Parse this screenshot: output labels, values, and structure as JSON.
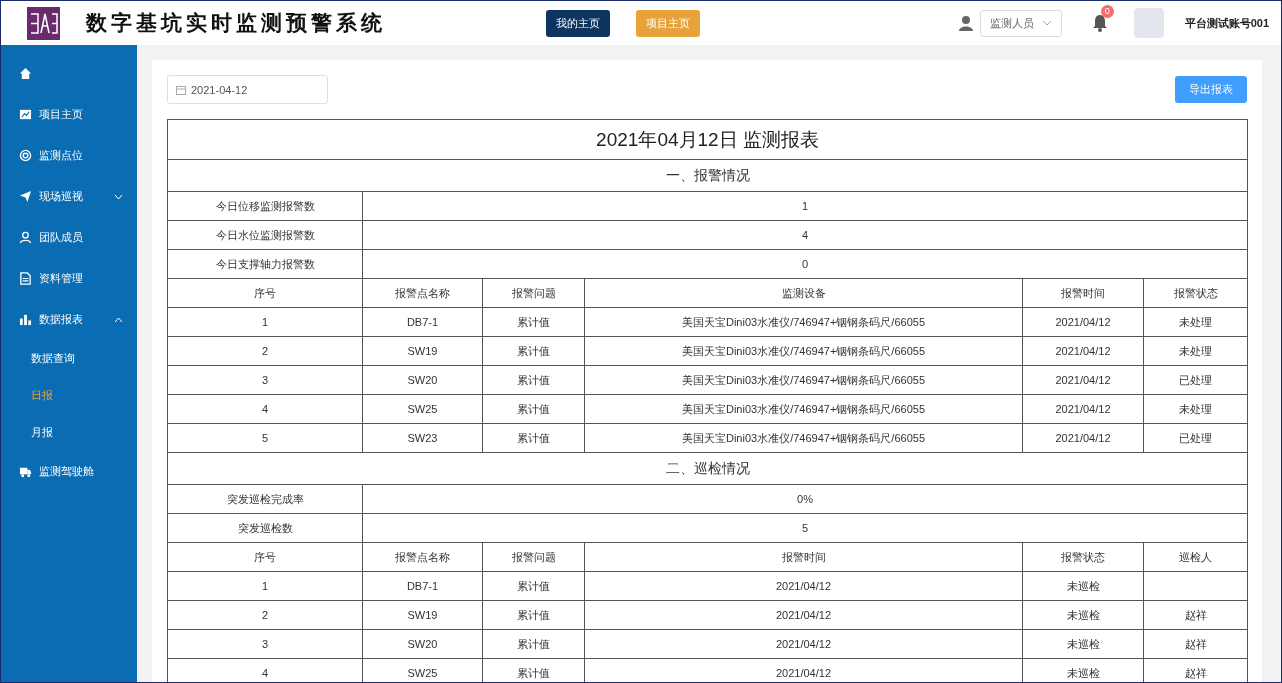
{
  "header": {
    "title": "数字基坑实时监测预警系统",
    "buttons": [
      {
        "label": "我的主页",
        "kind": "primary"
      },
      {
        "label": "项目主页",
        "kind": "warning"
      }
    ],
    "role_select": {
      "value": "监测人员"
    },
    "notifications": {
      "badge": "0"
    },
    "account": "平台测试账号001"
  },
  "sidebar": {
    "items": [
      {
        "kind": "home",
        "selected": false
      },
      {
        "kind": "chart",
        "label": "项目主页",
        "selected": false
      },
      {
        "kind": "target",
        "label": "监测点位",
        "selected": false
      },
      {
        "kind": "plane",
        "label": "现场巡视",
        "selected": false,
        "expanded": false
      },
      {
        "kind": "person",
        "label": "团队成员",
        "selected": false
      },
      {
        "kind": "document",
        "label": "资料管理",
        "selected": false
      },
      {
        "kind": "bars",
        "label": "数据报表",
        "selected": false,
        "expanded": true,
        "children": [
          {
            "label": "数据查询",
            "selected": false
          },
          {
            "label": "日报",
            "selected": true
          },
          {
            "label": "月报",
            "selected": false
          }
        ]
      },
      {
        "kind": "truck",
        "label": "监测驾驶舱",
        "selected": false
      }
    ]
  },
  "report": {
    "date_field": {
      "value": "2021-04-12"
    },
    "export_button": "导出报表",
    "title": "2021年04月12日 监测报表",
    "sections": [
      {
        "heading": "一、报警情况",
        "summary": [
          {
            "label": "今日位移监测报警数",
            "value": "1"
          },
          {
            "label": "今日水位监测报警数",
            "value": "4"
          },
          {
            "label": "今日支撑轴力报警数",
            "value": "0"
          }
        ],
        "columns": [
          "序号",
          "报警点名称",
          "报警问题",
          "监测设备",
          "报警时间",
          "报警状态"
        ],
        "rows": [
          [
            "1",
            "DB7-1",
            "累计值",
            "美国天宝Dini03水准仪/746947+铟钢条码尺/66055",
            "2021/04/12",
            "未处理"
          ],
          [
            "2",
            "SW19",
            "累计值",
            "美国天宝Dini03水准仪/746947+铟钢条码尺/66055",
            "2021/04/12",
            "未处理"
          ],
          [
            "3",
            "SW20",
            "累计值",
            "美国天宝Dini03水准仪/746947+铟钢条码尺/66055",
            "2021/04/12",
            "已处理"
          ],
          [
            "4",
            "SW25",
            "累计值",
            "美国天宝Dini03水准仪/746947+铟钢条码尺/66055",
            "2021/04/12",
            "未处理"
          ],
          [
            "5",
            "SW23",
            "累计值",
            "美国天宝Dini03水准仪/746947+铟钢条码尺/66055",
            "2021/04/12",
            "已处理"
          ]
        ]
      },
      {
        "heading": "二、巡检情况",
        "summary": [
          {
            "label": "突发巡检完成率",
            "value": "0%"
          },
          {
            "label": "突发巡检数",
            "value": "5"
          }
        ],
        "columns": [
          "序号",
          "报警点名称",
          "报警问题",
          "报警时间",
          "报警状态",
          "巡检人"
        ],
        "rows": [
          [
            "1",
            "DB7-1",
            "累计值",
            "2021/04/12",
            "未巡检",
            null
          ],
          [
            "2",
            "SW19",
            "累计值",
            "2021/04/12",
            "未巡检",
            "赵祥"
          ],
          [
            "3",
            "SW20",
            "累计值",
            "2021/04/12",
            "未巡检",
            "赵祥"
          ],
          [
            "4",
            "SW25",
            "累计值",
            "2021/04/12",
            "未巡检",
            "赵祥"
          ]
        ]
      }
    ]
  }
}
